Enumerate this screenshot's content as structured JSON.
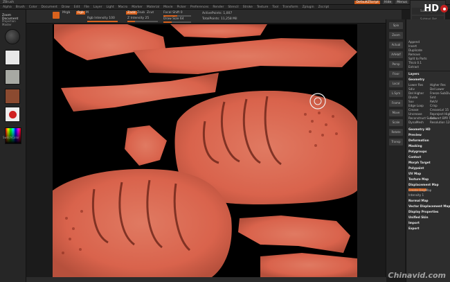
{
  "window": {
    "title": "ZBrush",
    "buttons": [
      "DefaultZScript",
      "Hide",
      "Menus"
    ]
  },
  "menus": [
    "Alpha",
    "Brush",
    "Color",
    "Document",
    "Draw",
    "Edit",
    "File",
    "Layer",
    "Light",
    "Macro",
    "Marker",
    "Material",
    "Movie",
    "Picker",
    "Preferences",
    "Render",
    "Stencil",
    "Stroke",
    "Texture",
    "Tool",
    "Transform",
    "Zplugin",
    "Zscript"
  ],
  "toolbar": {
    "mrgb": "Mrgb",
    "rgb": "Rgb",
    "m": "M",
    "rgb_intensity": "Rgb Intensity 100",
    "zadd": "Zadd",
    "zsub": "Zsub",
    "zcut": "Zcut",
    "z_intensity": "Z Intensity 25",
    "focal_shift": "Focal Shift 0",
    "draw_size": "Draw Size 64",
    "active_points": "ActivePoints: 1,007",
    "total_points": "TotalPoints: 11,258 Mil"
  },
  "left_shelf": {
    "title": "Zoom Document",
    "projection": "Projection Master",
    "lightbox": "LightBox",
    "quick_sketch": "Quick Sketch",
    "color_label": "SwitchColor"
  },
  "right_shelf": [
    "Spix",
    "Zoom",
    "Actual",
    "AAHalf",
    "Persp",
    "Floor",
    "Local",
    "L.Sym",
    "Frame",
    "Move",
    "Scale",
    "Rotate",
    "Transp"
  ],
  "subtool_panel": [
    "Subtool_Top",
    "Subtool_Bot",
    "visible count"
  ],
  "tray": {
    "items_top": [
      "Append",
      "Insert",
      "Duplicate",
      "Remove",
      "Split to Parts",
      "Thick 0.1",
      "Extract"
    ],
    "layers": "Layers",
    "geometry": "Geometry",
    "geo_controls": [
      "Lower Res",
      "Higher Res",
      "Sdiv",
      "Del Lower",
      "Del Higher",
      "Freeze SubDivision",
      "Divide",
      "Smt",
      "Suv",
      "ReUV",
      "Edge Loop",
      "Crisp",
      "Crease",
      "CreaseLvl 15",
      "Uncrease",
      "Reproject Higher Subdiv",
      "Reconstruct Subdiv",
      "Convert BPR To Geo",
      "DynaMesh",
      "Resolution 128"
    ],
    "sections": [
      "Geometry HD",
      "Preview",
      "Deformation",
      "Masking",
      "Polygroups",
      "Contact",
      "Morph Target",
      "Polypaint",
      "UV Map",
      "Texture Map",
      "Displacement Map",
      "Normal Map",
      "Vector Displacement Map",
      "Display Properties",
      "Unified Skin",
      "Import",
      "Export"
    ],
    "disp": {
      "create": "Create DispMap",
      "mid": "DPSubPix",
      "intensity": "Intensity 1",
      "mode": "Mode"
    }
  },
  "watermark": "Chinavid.com",
  "colors": {
    "accent": "#d9621d",
    "texture": "#d96850",
    "record": "#c62020"
  }
}
